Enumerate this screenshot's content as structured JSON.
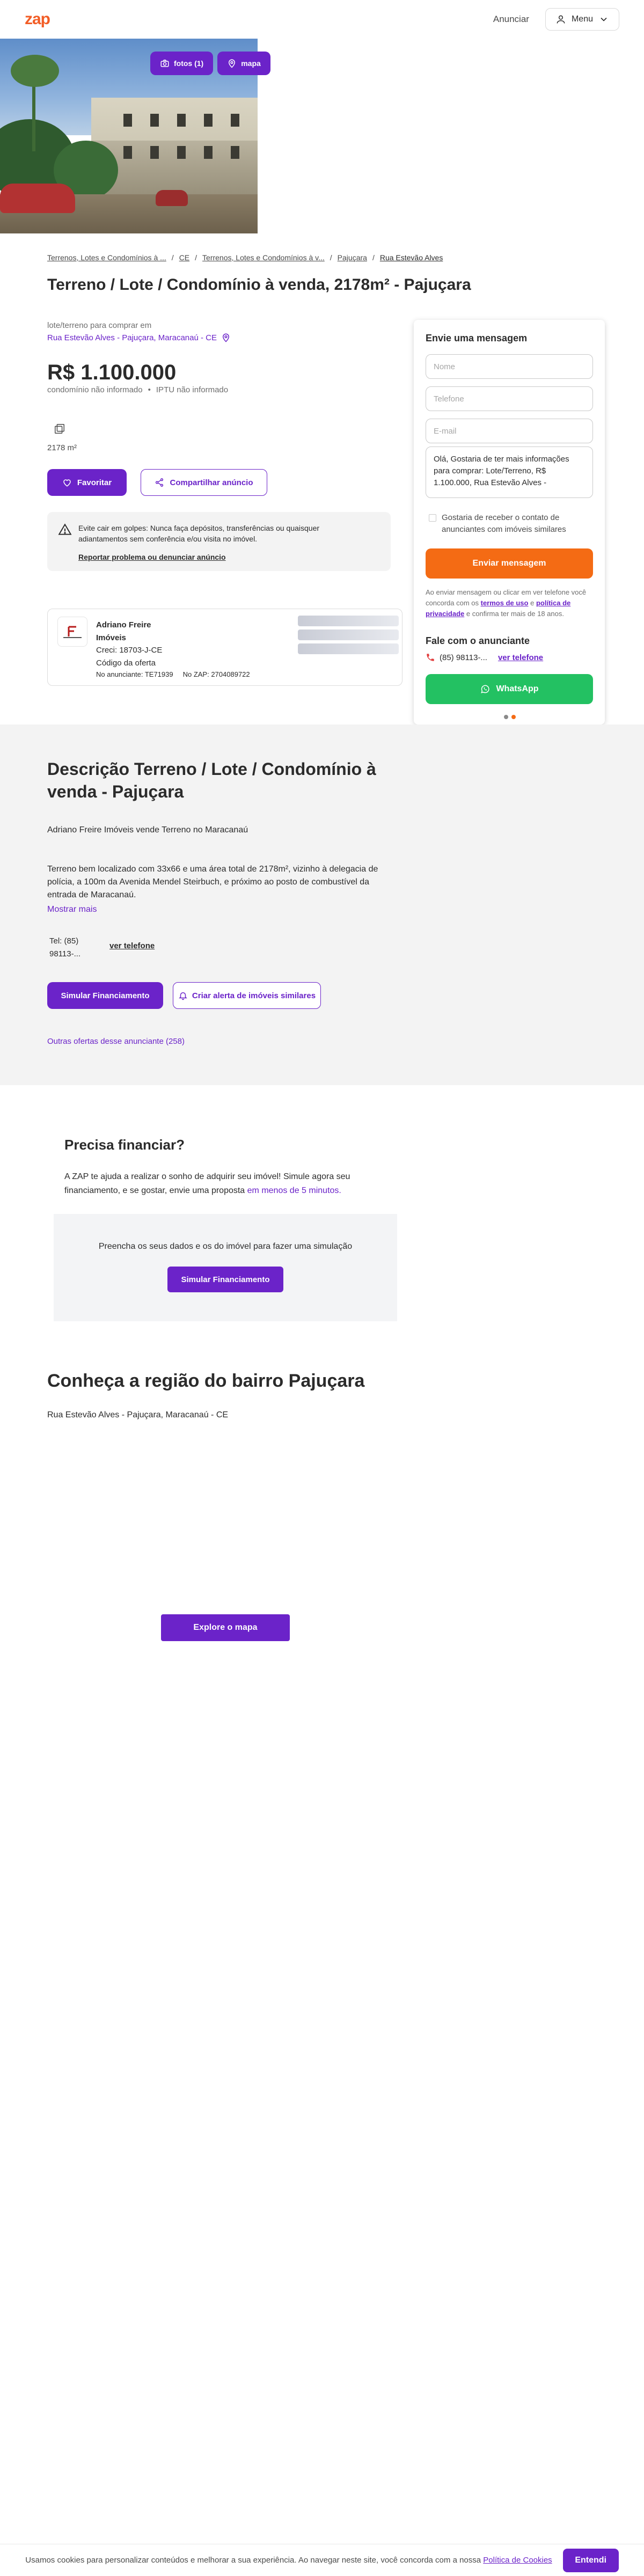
{
  "header": {
    "logo": "zap",
    "anunciar": "Anunciar",
    "menu": "Menu"
  },
  "hero": {
    "photos_label": "fotos (1)",
    "map_label": "mapa"
  },
  "breadcrumb": [
    "Terrenos, Lotes e Condomínios à ...",
    "CE",
    "Terrenos, Lotes e Condomínios à v...",
    "Pajuçara",
    "Rua Estevão Alves"
  ],
  "listing": {
    "title": "Terreno / Lote / Condomínio à venda, 2178m² - Pajuçara",
    "type": "lote/terreno para comprar em",
    "address": "Rua Estevão Alves - Pajuçara, Maracanaú - CE",
    "price": "R$ 1.100.000",
    "condo": "condomínio não informado",
    "iptu": "IPTU não informado",
    "area": "2178 m²",
    "favorite": "Favoritar",
    "share": "Compartilhar anúncio"
  },
  "alert": {
    "text": "Evite cair em golpes: Nunca faça depósitos, transferências ou quaisquer adiantamentos sem conferência e/ou visita no imóvel.",
    "link": "Reportar problema ou denunciar anúncio"
  },
  "advertiser": {
    "name": "Adriano Freire Imóveis",
    "creci": "Creci: 18703-J-CE",
    "code_label": "Código da oferta",
    "code_advertiser": "No anunciante: TE71939",
    "code_zap": "No ZAP: 2704089722"
  },
  "form": {
    "title": "Envie uma mensagem",
    "name_placeholder": "Nome",
    "phone_placeholder": "Telefone",
    "email_placeholder": "E-mail",
    "message": "Olá, Gostaria de ter mais informações para comprar: Lote/Terreno, R$ 1.100.000, Rua Estevão Alves -",
    "optin": "Gostaria de receber o contato de anunciantes com imóveis similares",
    "send": "Enviar mensagem",
    "terms_1": "Ao enviar mensagem ou clicar em ver telefone você concorda com os",
    "terms_link_1": "termos de uso",
    "terms_2": "e",
    "terms_link_2": "política de privacidade",
    "terms_3": "e confirma ter mais de 18 anos.",
    "contact_title": "Fale com o anunciante",
    "phone": "(85) 98113-...",
    "see_phone": "ver telefone",
    "whatsapp": "WhatsApp"
  },
  "description": {
    "title": "Descrição Terreno / Lote / Condomínio à venda - Pajuçara",
    "intro": "Adriano Freire Imóveis vende Terreno no Maracanaú",
    "body": "Terreno bem localizado com 33x66 e uma área total de 2178m², vizinho à delegacia de polícia, a 100m da Avenida Mendel Steirbuch, e próximo ao posto de combustível da entrada de Maracanaú.",
    "show_more": "Mostrar mais",
    "tel": "Tel: (85) 98113-...",
    "see_phone": "ver telefone",
    "simulate": "Simular Financiamento",
    "create_alert": "Criar alerta de imóveis similares",
    "other_offers": "Outras ofertas desse anunciante (258)"
  },
  "financing": {
    "title": "Precisa financiar?",
    "text": "A ZAP te ajuda a realizar o sonho de adquirir seu imóvel! Simule agora seu financiamento, e se gostar, envie uma proposta",
    "text_accent": "em menos de 5 minutos.",
    "box_text": "Preencha os seus dados e os do imóvel para fazer uma simulação",
    "box_button": "Simular Financiamento"
  },
  "region": {
    "title": "Conheça a região do bairro Pajuçara",
    "address": "Rua Estevão Alves - Pajuçara, Maracanaú - CE",
    "map_button": "Explore o mapa"
  },
  "cookie": {
    "text": "Usamos cookies para personalizar conteúdos e melhorar a sua experiência. Ao navegar neste site, você concorda com a nossa",
    "link": "Política de Cookies",
    "button": "Entendi"
  },
  "colors": {
    "brand_purple": "#6b23c9",
    "brand_orange": "#f25d26",
    "send_orange": "#f46b14",
    "whatsapp_green": "#23c162"
  }
}
